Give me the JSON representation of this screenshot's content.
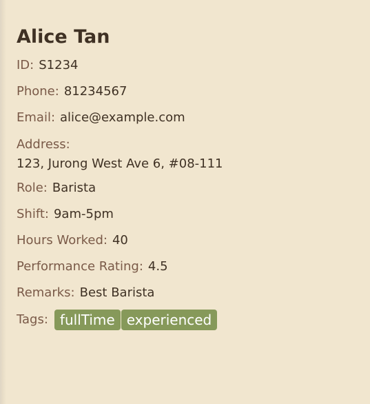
{
  "person": {
    "name": "Alice Tan",
    "fields": {
      "id": {
        "label": "ID:",
        "value": "S1234"
      },
      "phone": {
        "label": "Phone:",
        "value": "81234567"
      },
      "email": {
        "label": "Email:",
        "value": "alice@example.com"
      },
      "address": {
        "label": "Address:",
        "value": "123, Jurong West Ave 6, #08-111"
      },
      "role": {
        "label": "Role:",
        "value": "Barista"
      },
      "shift": {
        "label": "Shift:",
        "value": "9am-5pm"
      },
      "hours": {
        "label": "Hours Worked:",
        "value": "40"
      },
      "rating": {
        "label": "Performance Rating:",
        "value": "4.5"
      },
      "remarks": {
        "label": "Remarks:",
        "value": "Best Barista"
      }
    },
    "tags": {
      "label": "Tags:",
      "items": [
        "fullTime",
        "experienced"
      ]
    }
  },
  "colors": {
    "background": "#f1e6cf",
    "label": "#7a5a48",
    "value": "#3f3124",
    "tag_background": "#86995a",
    "tag_text": "#ffffff"
  }
}
